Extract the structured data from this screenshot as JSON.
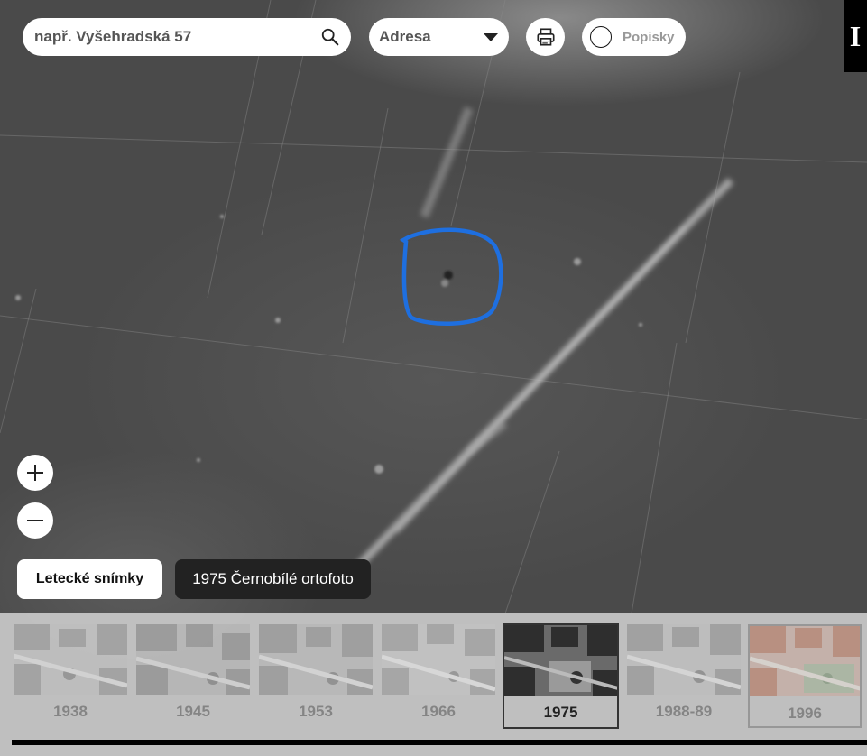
{
  "search": {
    "placeholder": "např. Vyšehradská 57"
  },
  "search_mode": {
    "selected": "Adresa"
  },
  "labels_toggle": {
    "label": "Popisky"
  },
  "info_button": {
    "label": "I"
  },
  "layer": {
    "button_label": "Letecké snímky",
    "caption": "1975 Černobílé ortofoto"
  },
  "timeline": {
    "items": [
      {
        "year": "1938",
        "active": false
      },
      {
        "year": "1945",
        "active": false
      },
      {
        "year": "1953",
        "active": false
      },
      {
        "year": "1966",
        "active": false
      },
      {
        "year": "1975",
        "active": true
      },
      {
        "year": "1988-89",
        "active": false
      },
      {
        "year": "1996",
        "active": false
      }
    ]
  },
  "colors": {
    "marker": "#1e6fe0",
    "active_border": "#333333"
  },
  "icons": [
    "search-icon",
    "chevron-down-icon",
    "printer-icon",
    "plus-icon",
    "minus-icon"
  ]
}
